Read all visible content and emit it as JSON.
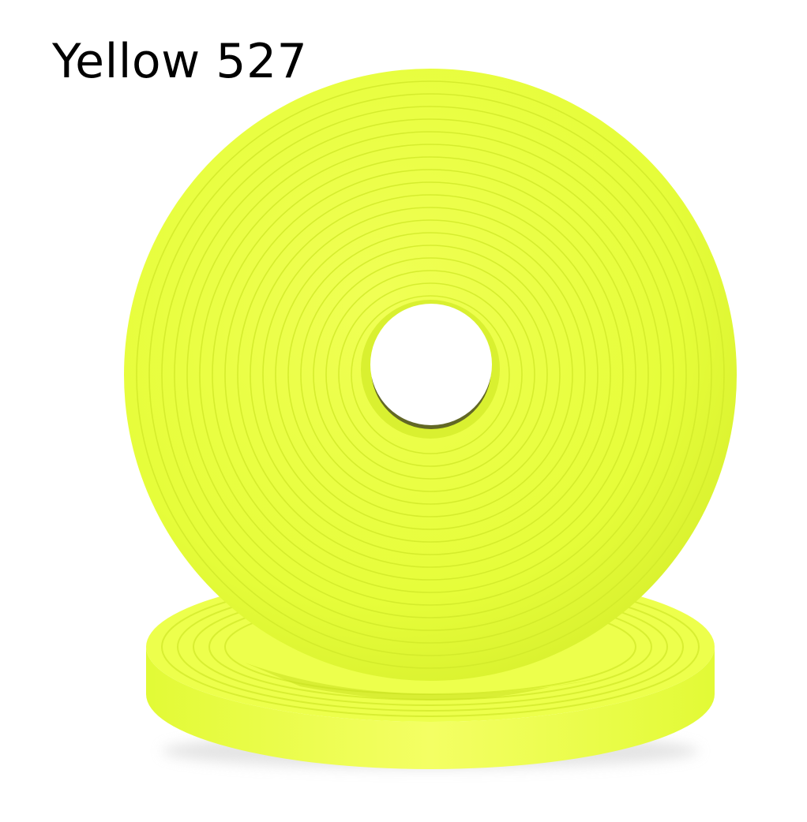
{
  "product": {
    "label": "Yellow 527",
    "color": "#E8FF3C"
  },
  "palette": {
    "tape": "#E8FF3C",
    "tape_light": "#F2FF5E",
    "tape_dark": "#D4EA24",
    "groove": "#C9DF2A",
    "core_hole": "#FFFFFF",
    "core_shadow": "#2A2A1A"
  },
  "image": {
    "description_icon": "tape-roll-icon"
  }
}
